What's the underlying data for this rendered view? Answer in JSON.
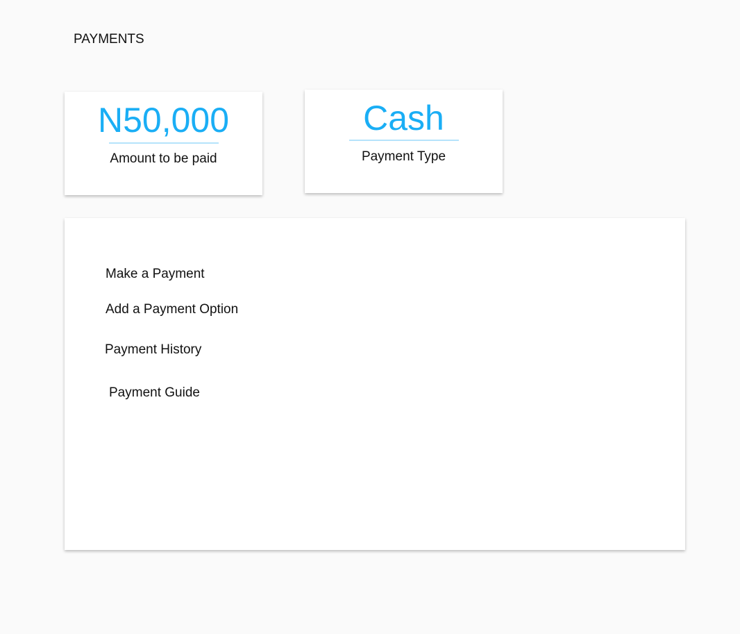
{
  "header": {
    "title": "PAYMENTS"
  },
  "cards": [
    {
      "value": "N50,000",
      "label": "Amount to be paid"
    },
    {
      "value": "Cash",
      "label": "Payment Type"
    }
  ],
  "menu": [
    {
      "label": "Make a Payment"
    },
    {
      "label": "Add a Payment Option"
    },
    {
      "label": "Payment History"
    },
    {
      "label": "Payment Guide"
    }
  ],
  "colors": {
    "accent": "#1aaef5",
    "rule": "#b5e3fb",
    "background": "#fafafa"
  }
}
